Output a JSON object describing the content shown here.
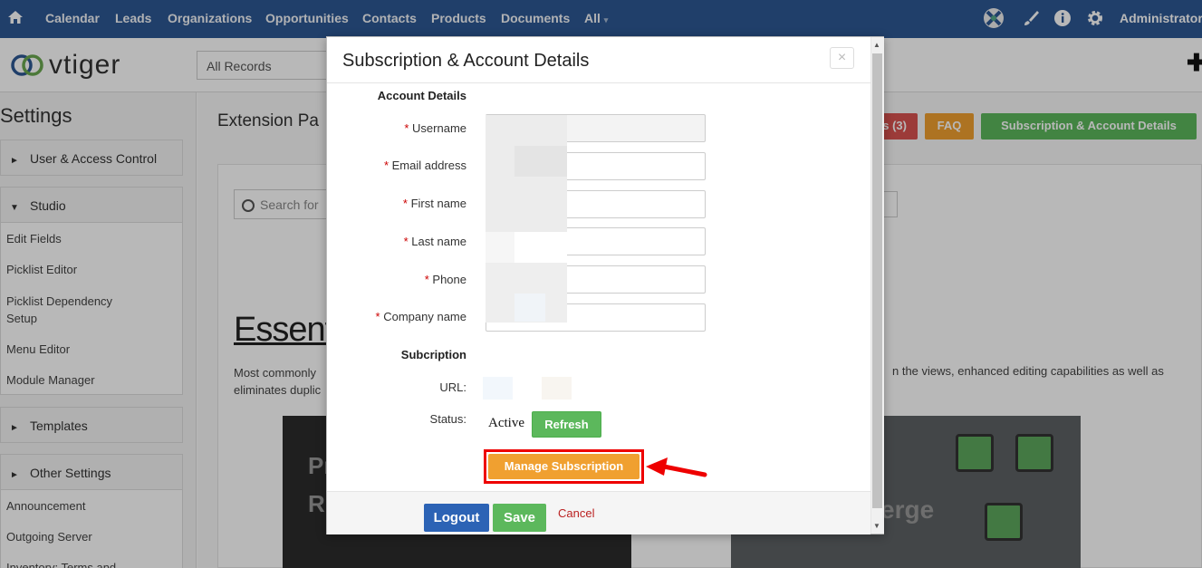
{
  "topnav": {
    "items": [
      "Calendar",
      "Leads",
      "Organizations",
      "Opportunities",
      "Contacts",
      "Products",
      "Documents",
      "All"
    ],
    "user": "Administrator"
  },
  "header": {
    "logo_text": "vtiger",
    "records_select": "All Records"
  },
  "sidebar": {
    "title": "Settings",
    "groups": {
      "user_access": "User & Access Control",
      "studio": "Studio",
      "templates": "Templates",
      "other_settings": "Other Settings"
    },
    "studio_items": [
      "Edit Fields",
      "Picklist Editor",
      "Picklist Dependency Setup",
      "Menu Editor",
      "Module Manager"
    ],
    "other_items": [
      "Announcement",
      "Outgoing Server",
      "Inventory: Terms and"
    ]
  },
  "main": {
    "title": "Extension Pa",
    "buttons": {
      "updates": "s (3)",
      "faq": "FAQ",
      "subscription": "Subscription & Account Details"
    },
    "search_placeholder": "Search for",
    "essentials": "Essent",
    "desc_left": "Most commonly",
    "desc_left2": "eliminates duplic",
    "desc_right": "n the views, enhanced editing capabilities as well as",
    "card1_line1": "Pr",
    "card1_line2": "R",
    "card2_text": "erge"
  },
  "modal": {
    "title": "Subscription & Account Details",
    "close": "×",
    "account_section": "Account Details",
    "fields": [
      "Username",
      "Email address",
      "First name",
      "Last name",
      "Phone",
      "Company name"
    ],
    "subscription_section": "Subcription",
    "url_label": "URL:",
    "status_label": "Status:",
    "status_value": "Active",
    "refresh": "Refresh",
    "manage": "Manage Subscription",
    "logout": "Logout",
    "save": "Save",
    "cancel": "Cancel"
  },
  "colors": {
    "nav_bg": "#2d5894",
    "red_button": "#d9534f",
    "orange_button": "#f0a030",
    "green_button": "#5cb85c",
    "logout_blue": "#2c63b5",
    "highlight": "#ee0000"
  }
}
